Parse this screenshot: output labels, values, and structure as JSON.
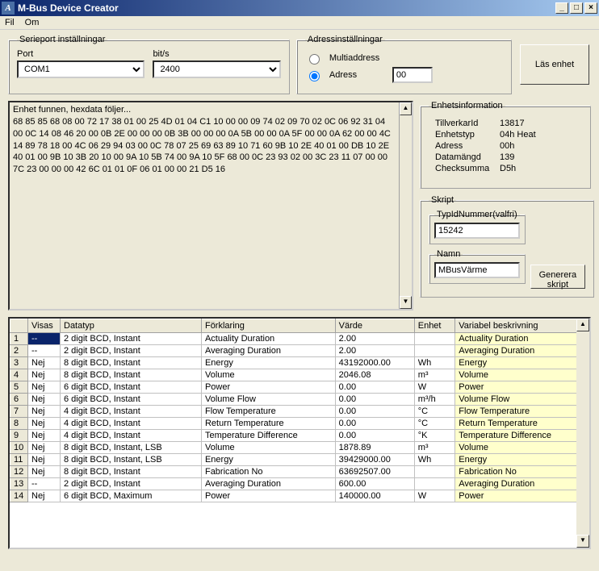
{
  "window": {
    "title": "M-Bus Device Creator"
  },
  "menu": {
    "fil": "Fil",
    "om": "Om"
  },
  "serieport": {
    "legend": "Serieport inställningar",
    "port_label": "Port",
    "port_value": "COM1",
    "bits_label": "bit/s",
    "bits_value": "2400"
  },
  "adress": {
    "legend": "Adressinställningar",
    "multi_label": "Multiaddress",
    "adress_label": "Adress",
    "adress_value": "00"
  },
  "las_btn": "Läs enhet",
  "hex": {
    "intro": "Enhet funnen, hexdata följer...",
    "data": "68 85 85 68 08 00 72 17 38 01 00 25 4D 01 04 C1 10 00 00 09 74 02 09 70 02 0C 06 92 31 04 00 0C 14 08 46 20 00 0B 2E 00 00 00 0B 3B 00 00 00 0A 5B 00 00 0A 5F 00 00 0A 62 00 00 4C 14 89 78 18 00 4C 06 29 94 03 00 0C 78 07 25 69 63 89 10 71 60 9B 10 2E 40 01 00 DB 10 2E 40 01 00 9B 10 3B 20 10 00 9A 10 5B 74 00 9A 10 5F 68 00 0C 23 93 02 00 3C 23 11 07 00 00 7C 23 00 00 00 42 6C 01 01 0F 06 01 00 00 21 D5 16"
  },
  "info": {
    "legend": "Enhetsinformation",
    "tillverkarid_l": "TillverkarId",
    "tillverkarid_v": "13817",
    "enhetstyp_l": "Enhetstyp",
    "enhetstyp_v": "04h Heat",
    "adress_l": "Adress",
    "adress_v": "00h",
    "datamangd_l": "Datamängd",
    "datamangd_v": "139",
    "checksumma_l": "Checksumma",
    "checksumma_v": "D5h"
  },
  "skript": {
    "legend": "Skript",
    "typid_legend": "TypIdNummer(valfri)",
    "typid_value": "15242",
    "namn_legend": "Namn",
    "namn_value": "MBusVärme",
    "gen_btn": "Generera skript"
  },
  "table": {
    "headers": [
      "",
      "Visas",
      "Datatyp",
      "Förklaring",
      "Värde",
      "Enhet",
      "Variabel beskrivning"
    ],
    "rows": [
      {
        "n": "1",
        "visas": "--",
        "datatyp": "2 digit BCD, Instant",
        "fork": "Actuality Duration",
        "varde": "2.00",
        "enhet": "",
        "varb": "Actuality Duration",
        "sel": true
      },
      {
        "n": "2",
        "visas": "--",
        "datatyp": "2 digit BCD, Instant",
        "fork": "Averaging Duration",
        "varde": "2.00",
        "enhet": "",
        "varb": "Averaging Duration"
      },
      {
        "n": "3",
        "visas": "Nej",
        "datatyp": "8 digit BCD, Instant",
        "fork": "Energy",
        "varde": "43192000.00",
        "enhet": "Wh",
        "varb": "Energy"
      },
      {
        "n": "4",
        "visas": "Nej",
        "datatyp": "8 digit BCD, Instant",
        "fork": "Volume",
        "varde": "2046.08",
        "enhet": "m³",
        "varb": "Volume"
      },
      {
        "n": "5",
        "visas": "Nej",
        "datatyp": "6 digit BCD, Instant",
        "fork": "Power",
        "varde": "0.00",
        "enhet": "W",
        "varb": "Power"
      },
      {
        "n": "6",
        "visas": "Nej",
        "datatyp": "6 digit BCD, Instant",
        "fork": "Volume Flow",
        "varde": "0.00",
        "enhet": "m³/h",
        "varb": "Volume Flow"
      },
      {
        "n": "7",
        "visas": "Nej",
        "datatyp": "4 digit BCD, Instant",
        "fork": "Flow Temperature",
        "varde": "0.00",
        "enhet": "°C",
        "varb": "Flow Temperature"
      },
      {
        "n": "8",
        "visas": "Nej",
        "datatyp": "4 digit BCD, Instant",
        "fork": "Return Temperature",
        "varde": "0.00",
        "enhet": "°C",
        "varb": "Return Temperature"
      },
      {
        "n": "9",
        "visas": "Nej",
        "datatyp": "4 digit BCD, Instant",
        "fork": "Temperature Difference",
        "varde": "0.00",
        "enhet": "°K",
        "varb": "Temperature Difference"
      },
      {
        "n": "10",
        "visas": "Nej",
        "datatyp": "8 digit BCD, Instant, LSB",
        "fork": "Volume",
        "varde": "1878.89",
        "enhet": "m³",
        "varb": "Volume"
      },
      {
        "n": "11",
        "visas": "Nej",
        "datatyp": "8 digit BCD, Instant, LSB",
        "fork": "Energy",
        "varde": "39429000.00",
        "enhet": "Wh",
        "varb": "Energy"
      },
      {
        "n": "12",
        "visas": "Nej",
        "datatyp": "8 digit BCD, Instant",
        "fork": "Fabrication No",
        "varde": "63692507.00",
        "enhet": "",
        "varb": "Fabrication No"
      },
      {
        "n": "13",
        "visas": "--",
        "datatyp": "2 digit BCD, Instant",
        "fork": "Averaging Duration",
        "varde": "600.00",
        "enhet": "",
        "varb": "Averaging Duration"
      },
      {
        "n": "14",
        "visas": "Nej",
        "datatyp": "6 digit BCD, Maximum",
        "fork": "Power",
        "varde": "140000.00",
        "enhet": "W",
        "varb": "Power"
      }
    ]
  }
}
